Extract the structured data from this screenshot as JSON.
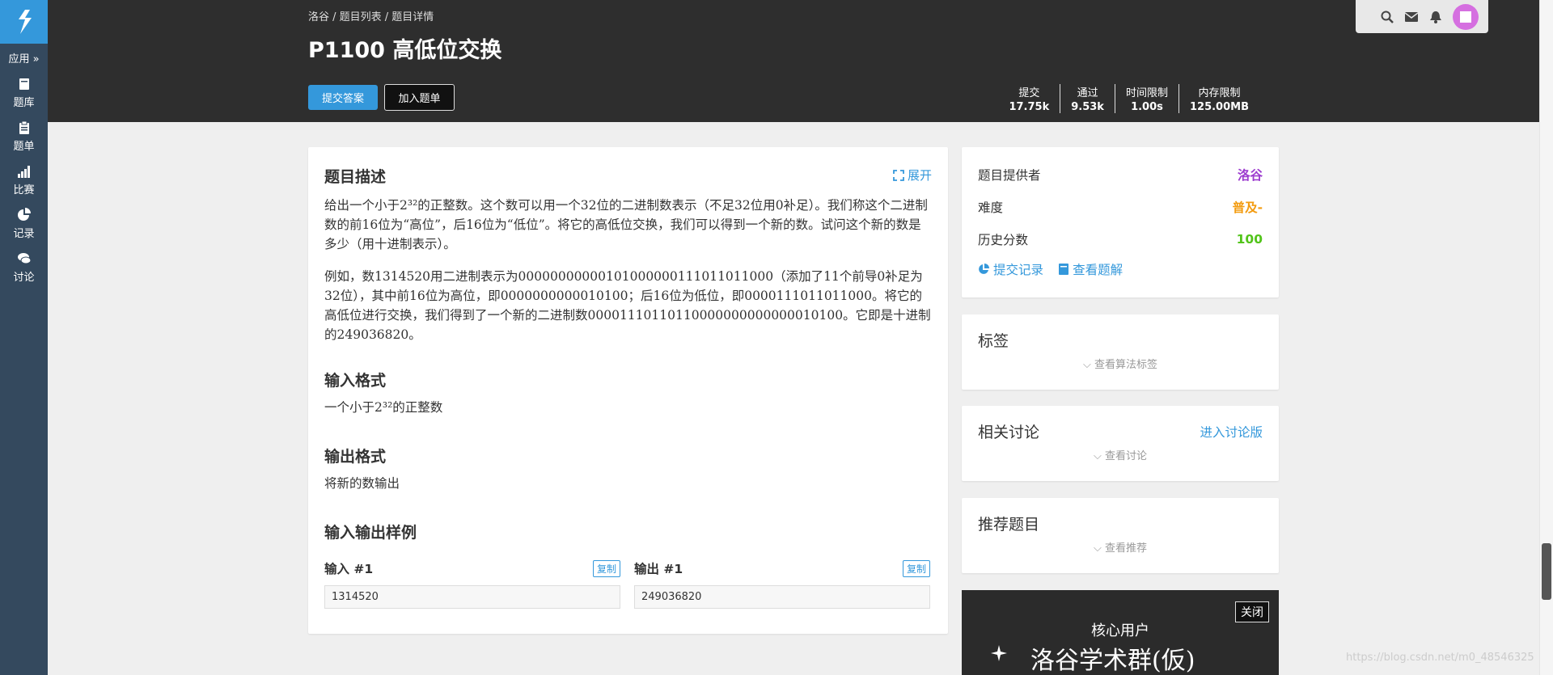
{
  "sidebar": {
    "logo_icon": "luogu-logo-icon",
    "app_label": "应用 »",
    "items": [
      {
        "icon": "book-icon",
        "label": "题库"
      },
      {
        "icon": "clipboard-icon",
        "label": "题单"
      },
      {
        "icon": "bar-chart-icon",
        "label": "比赛"
      },
      {
        "icon": "pie-chart-icon",
        "label": "记录"
      },
      {
        "icon": "comments-icon",
        "label": "讨论"
      }
    ]
  },
  "header": {
    "breadcrumb": "洛谷 / 题目列表 / 题目详情",
    "title": "P1100 高低位交换",
    "submit_button": "提交答案",
    "add_button": "加入题单",
    "stats": [
      {
        "label": "提交",
        "value": "17.75k"
      },
      {
        "label": "通过",
        "value": "9.53k"
      },
      {
        "label": "时间限制",
        "value": "1.00s"
      },
      {
        "label": "内存限制",
        "value": "125.00MB"
      }
    ]
  },
  "problem": {
    "desc_title": "题目描述",
    "expand_label": "展开",
    "desc_p1": "给出一个小于2³²的正整数。这个数可以用一个32位的二进制数表示（不足32位用0补足）。我们称这个二进制数的前16位为“高位”，后16位为“低位”。将它的高低位交换，我们可以得到一个新的数。试问这个新的数是多少（用十进制表示）。",
    "desc_p2": "例如，数1314520用二进制表示为0000000000010100000011101101100​0（添加了11个前导0补足为32位），其中前16位为高位，即0000000000010100；后16位为低位，即0000111011011000。将它的高低位进行交换，我们得到了一个新的二进制数00001110110110000000000000010100。它即是十进制的249036820。",
    "input_title": "输入格式",
    "input_text": "一个小于2³²的正整数",
    "output_title": "输出格式",
    "output_text": "将新的数输出",
    "sample_title": "输入输出样例",
    "input_label": "输入 #1",
    "output_label": "输出 #1",
    "copy_label": "复制",
    "sample_input": "1314520",
    "sample_output": "249036820"
  },
  "info": {
    "provider_label": "题目提供者",
    "provider_value": "洛谷",
    "difficulty_label": "难度",
    "difficulty_value": "普及-",
    "score_label": "历史分数",
    "score_value": "100",
    "record_link": "提交记录",
    "solution_link": "查看题解"
  },
  "tags": {
    "title": "标签",
    "toggle": "查看算法标签"
  },
  "discuss": {
    "title": "相关讨论",
    "link": "进入讨论版",
    "toggle": "查看讨论"
  },
  "recommend": {
    "title": "推荐题目",
    "toggle": "查看推荐"
  },
  "ad": {
    "close": "关闭",
    "line1": "核心用户",
    "line2": "洛谷学术群(仮)"
  },
  "watermark": "https://blog.csdn.net/m0_48546325",
  "colors": {
    "accent": "#3498db",
    "provider": "#9d3dcf",
    "difficulty": "#f39c11",
    "score": "#52c41a"
  }
}
